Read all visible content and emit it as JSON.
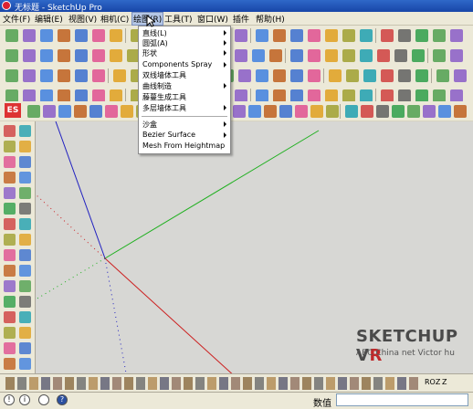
{
  "window": {
    "title": "无标题 - SketchUp Pro"
  },
  "menubar": {
    "items": [
      {
        "label": "文件(F)"
      },
      {
        "label": "编辑(E)"
      },
      {
        "label": "视图(V)"
      },
      {
        "label": "相机(C)"
      },
      {
        "label": "绘图(R)"
      },
      {
        "label": "工具(T)"
      },
      {
        "label": "窗口(W)"
      },
      {
        "label": "插件"
      },
      {
        "label": "帮助(H)"
      }
    ]
  },
  "draw_menu": {
    "items": [
      {
        "label": "直线(L)",
        "submenu": true
      },
      {
        "label": "圆弧(A)",
        "submenu": true
      },
      {
        "label": "形状",
        "submenu": true
      },
      {
        "label": "Components Spray",
        "submenu": true
      },
      {
        "label": "双线墙体工具",
        "submenu": false
      },
      {
        "label": "曲线制造",
        "submenu": true
      },
      {
        "label": "藤蔓生成工具",
        "submenu": false
      },
      {
        "label": "多层墙体工具",
        "submenu": true
      },
      {
        "label": "沙盒",
        "submenu": true
      },
      {
        "label": "Bezier Surface",
        "submenu": true
      },
      {
        "label": "Mesh From Heightmap",
        "submenu": false
      }
    ]
  },
  "watermark": {
    "brand_main": "SKETCHUP V",
    "brand_accent": "R",
    "sub": "ABC China net  Victor hu"
  },
  "status_bar": {
    "value_label": "数值",
    "value": ""
  },
  "bottom_toolbar": {
    "zoom_label": "ROZ",
    "z_label": "Z"
  },
  "colors": {
    "axis_red": "#cc2020",
    "axis_green": "#20b020",
    "axis_blue": "#2020c0",
    "viewport_bg": "#d7d7d4",
    "title_bar": "#2f68c8"
  }
}
